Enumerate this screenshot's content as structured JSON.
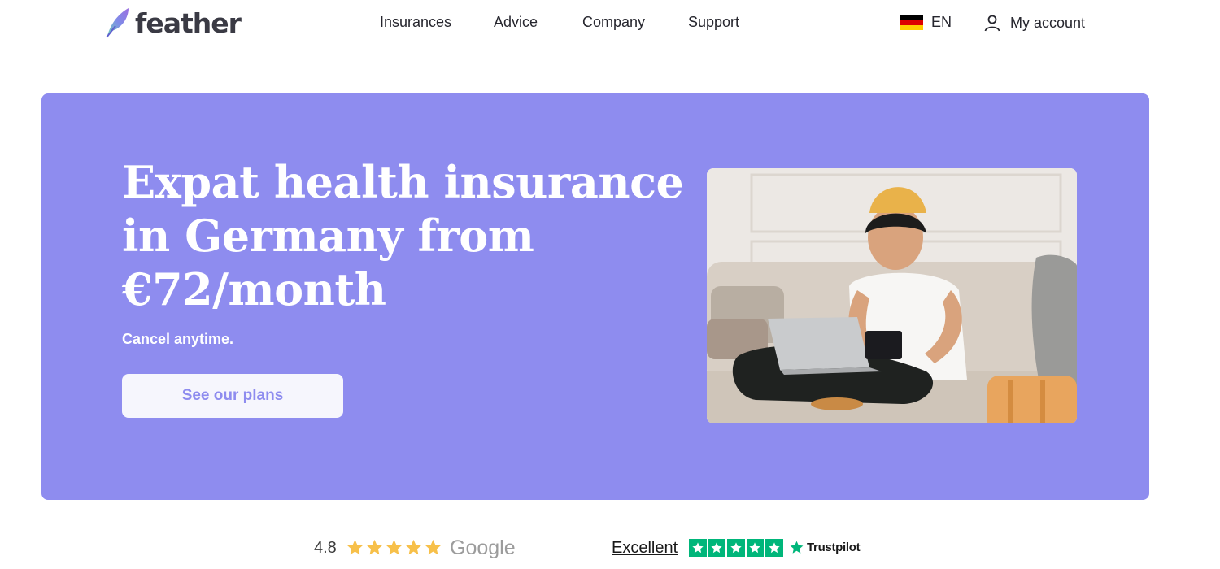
{
  "header": {
    "brand": "feather",
    "nav": [
      {
        "label": "Insurances"
      },
      {
        "label": "Advice"
      },
      {
        "label": "Company"
      },
      {
        "label": "Support"
      }
    ],
    "language": {
      "label": "EN",
      "flag": "flag-germany-icon"
    },
    "account": {
      "label": "My account",
      "icon": "user-icon"
    }
  },
  "hero": {
    "title": "Expat health insurance in Germany from €72/month",
    "subtitle": "Cancel anytime.",
    "cta_label": "See our plans",
    "background_color": "#8e8cef"
  },
  "ratings": {
    "google": {
      "score": "4.8",
      "stars": 5,
      "brand": "Google"
    },
    "trustpilot": {
      "label": "Excellent",
      "stars": 5,
      "brand": "Trustpilot"
    }
  },
  "colors": {
    "accent": "#8e8cef",
    "trustpilot_green": "#00b67a",
    "google_star": "#f7c04a"
  }
}
